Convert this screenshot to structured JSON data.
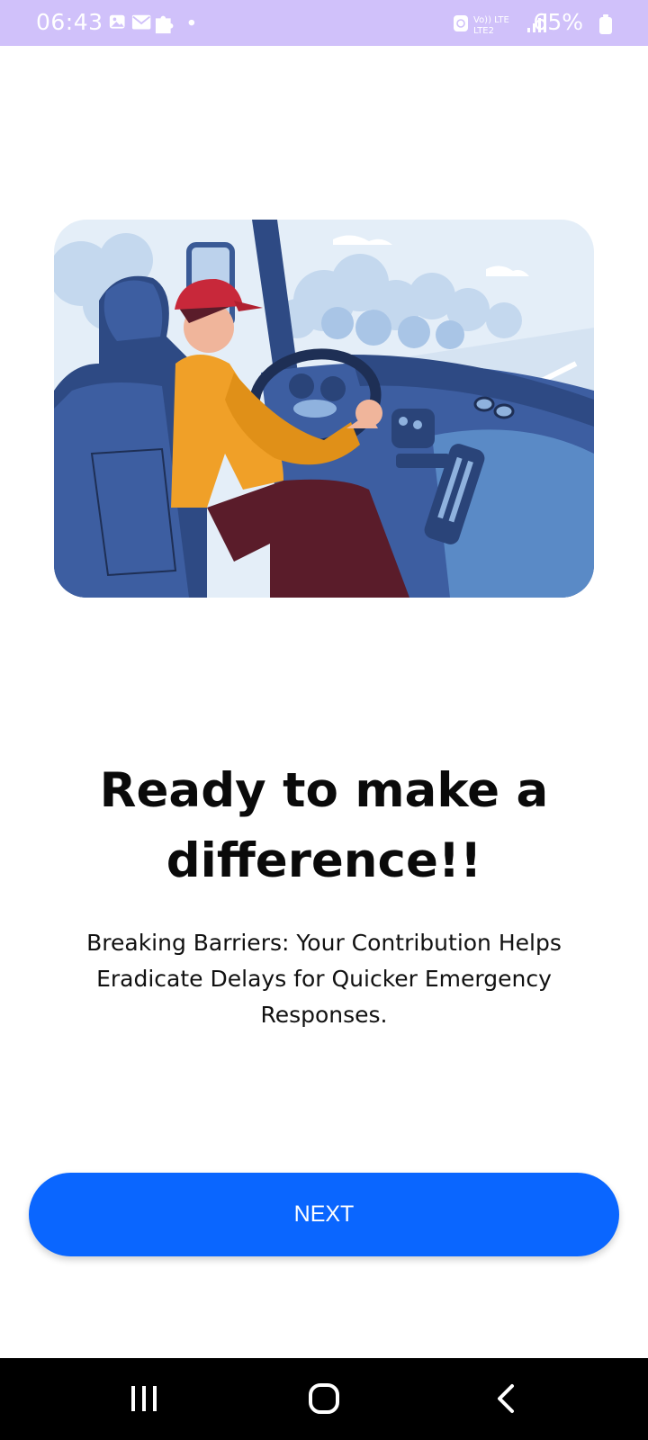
{
  "status_bar": {
    "time": "06:43",
    "battery_percent": "65%",
    "network_label_top": "Vo)) LTE",
    "network_label_bottom": "LTE2",
    "icons": [
      "gallery-icon",
      "mail-icon",
      "puzzle-icon",
      "dot-icon",
      "alarm-icon",
      "signal-icon",
      "battery-icon"
    ],
    "background_color": "#d0c1fa"
  },
  "onboarding": {
    "illustration": "bus-driver-illustration",
    "headline": "Ready to make a difference!!",
    "description": "Breaking Barriers: Your Contribution Helps Eradicate Delays for Quicker Emergency Responses."
  },
  "next_button": {
    "label": "NEXT",
    "color": "#0a66ff"
  },
  "nav_bar": {
    "buttons": [
      "recent-apps-icon",
      "home-icon",
      "back-icon"
    ]
  }
}
